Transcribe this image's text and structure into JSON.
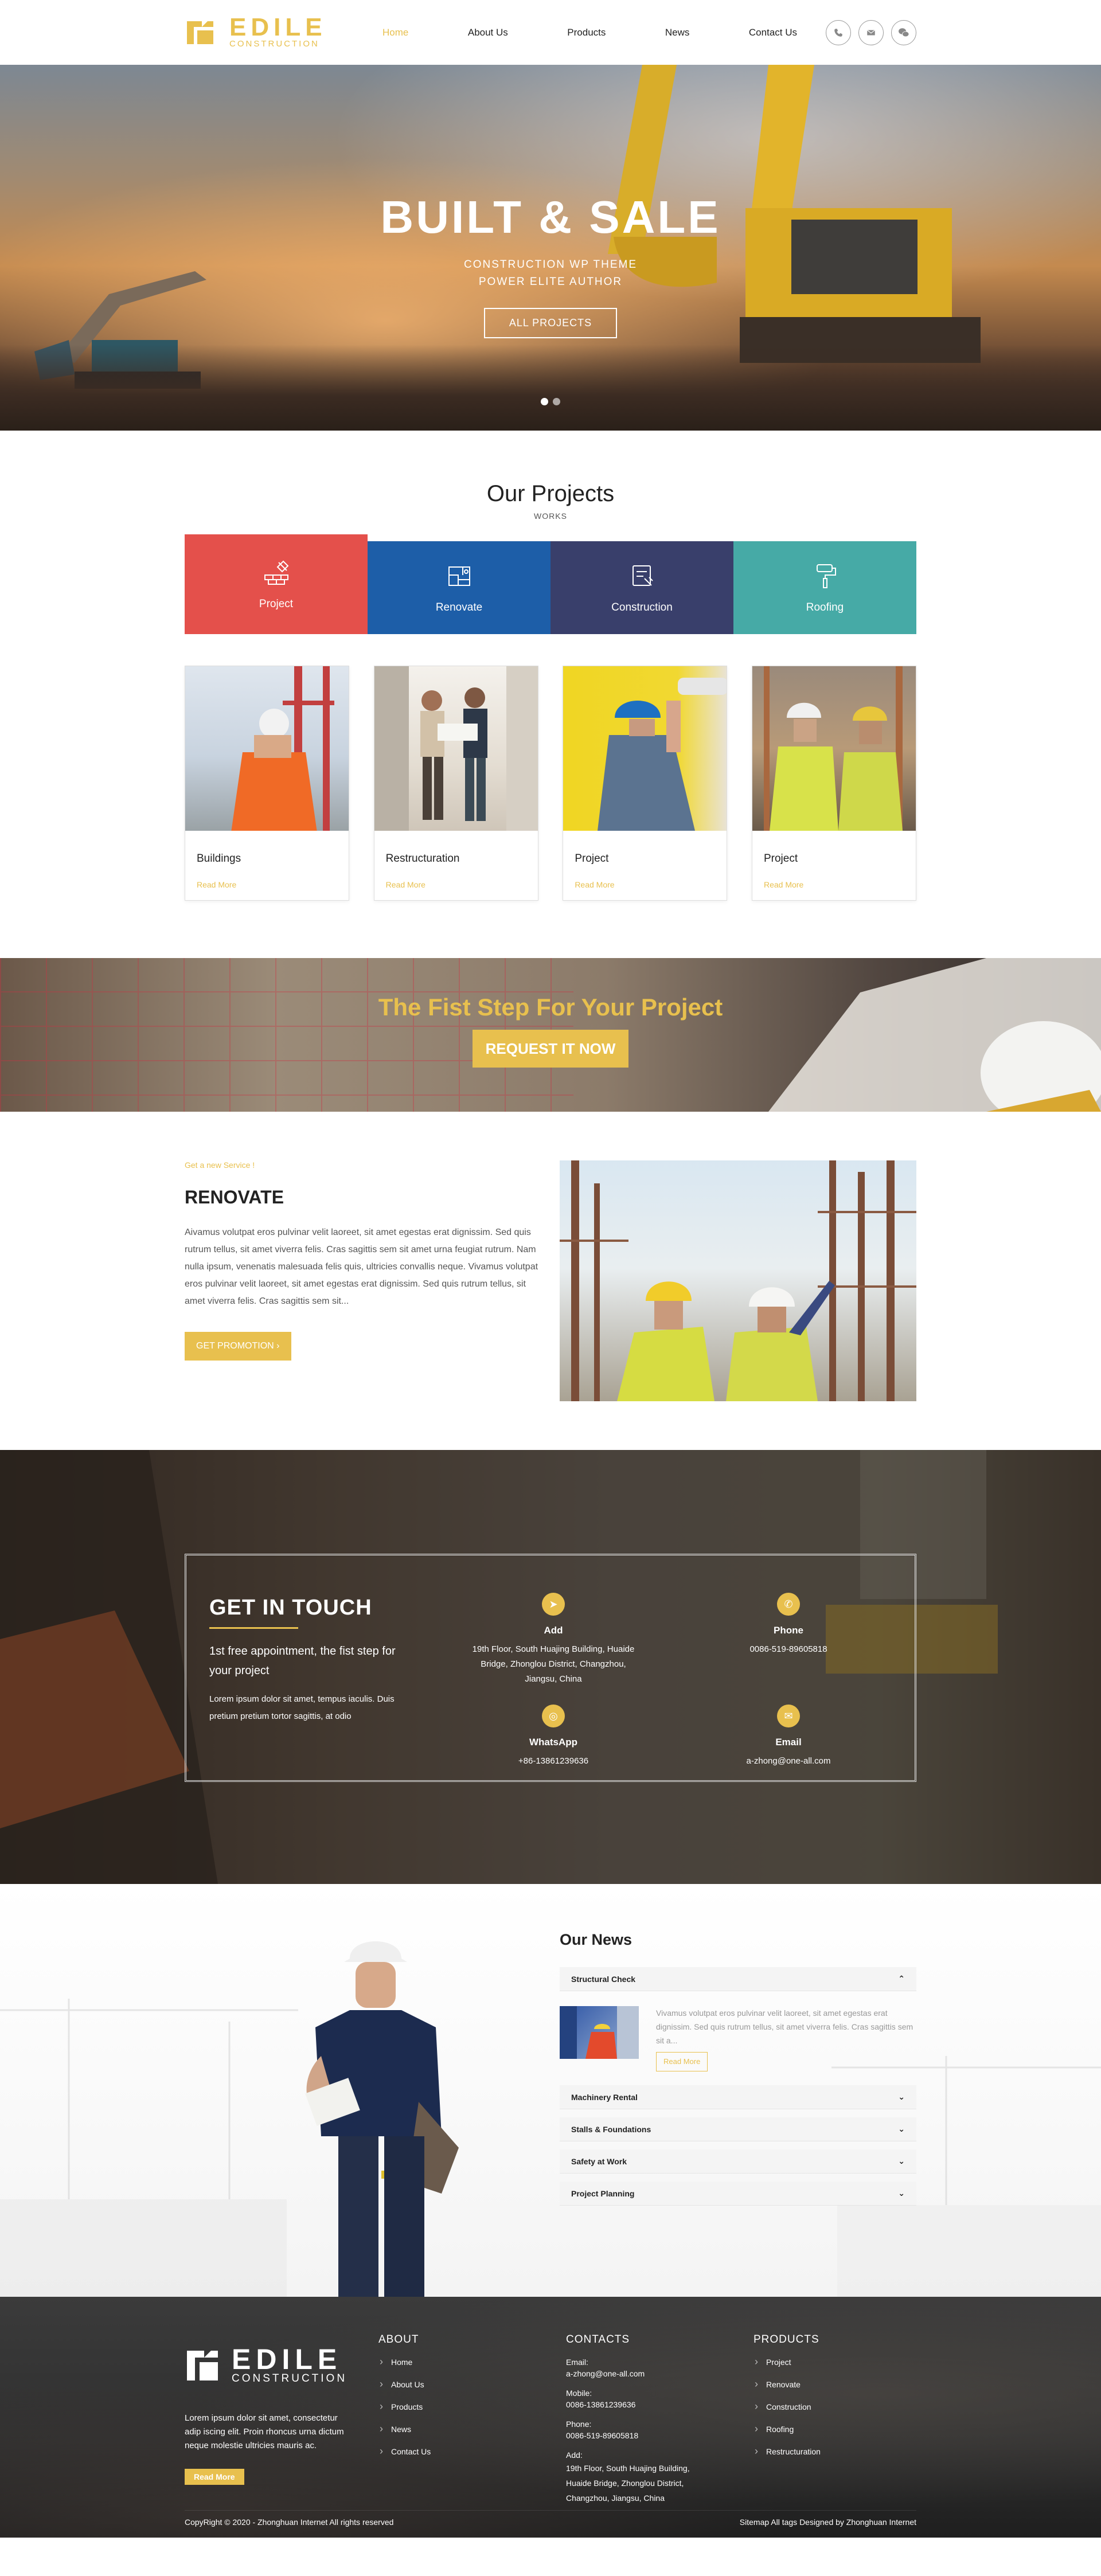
{
  "header": {
    "logo_big": "EDILE",
    "logo_small": "CONSTRUCTION",
    "nav": [
      "Home",
      "About Us",
      "Products",
      "News",
      "Contact Us"
    ],
    "icons": [
      "phone-icon",
      "mail-icon",
      "wechat-icon"
    ]
  },
  "hero": {
    "title": "BUILT & SALE",
    "sub1": "CONSTRUCTION WP THEME",
    "sub2": "POWER ELITE AUTHOR",
    "button": "ALL PROJECTS",
    "slides": 2,
    "active_slide": 1
  },
  "projects": {
    "title": "Our Projects",
    "subtitle": "WORKS",
    "tabs": [
      {
        "label": "Project",
        "color": "#e4504b",
        "icon": "bricks-icon"
      },
      {
        "label": "Renovate",
        "color": "#1d5ea8",
        "icon": "blueprint-icon"
      },
      {
        "label": "Construction",
        "color": "#393f6b",
        "icon": "tools-icon"
      },
      {
        "label": "Roofing",
        "color": "#46aaa6",
        "icon": "paint-roller-icon"
      }
    ],
    "cards": [
      {
        "title": "Buildings",
        "link": "Read More"
      },
      {
        "title": "Restructuration",
        "link": "Read More"
      },
      {
        "title": "Project",
        "link": "Read More"
      },
      {
        "title": "Project",
        "link": "Read More"
      }
    ]
  },
  "cta": {
    "title": "The Fist Step For Your Project",
    "button": "REQUEST IT NOW"
  },
  "renovate": {
    "kicker": "Get a new Service !",
    "title": "RENOVATE",
    "text": "Aivamus volutpat eros pulvinar velit laoreet, sit amet egestas erat dignissim. Sed quis rutrum tellus, sit amet viverra felis. Cras sagittis sem sit amet urna feugiat rutrum. Nam nulla ipsum, venenatis malesuada felis quis, ultricies convallis neque. Vivamus volutpat eros pulvinar velit laoreet, sit amet egestas erat dignissim. Sed quis rutrum tellus, sit amet viverra felis. Cras sagittis sem sit...",
    "button": "GET PROMOTION"
  },
  "touch": {
    "title": "GET IN TOUCH",
    "lead": "1st free appointment, the fist step for your project",
    "desc": "Lorem ipsum dolor sit amet, tempus iaculis. Duis pretium pretium tortor sagittis, at odio",
    "items": [
      {
        "label": "Add",
        "value": "19th Floor, South Huajing Building, Huaide Bridge, Zhonglou District, Changzhou, Jiangsu, China",
        "icon": "send-icon"
      },
      {
        "label": "Phone",
        "value": "0086-519-89605818",
        "icon": "phone-icon"
      },
      {
        "label": "WhatsApp",
        "value": "+86-13861239636",
        "icon": "whatsapp-icon"
      },
      {
        "label": "Email",
        "value": "a-zhong@one-all.com",
        "icon": "mail-icon"
      }
    ]
  },
  "news": {
    "title": "Our News",
    "open_item": {
      "title": "Structural Check",
      "text": "Vivamus volutpat eros pulvinar velit laoreet, sit amet egestas erat dignissim. Sed quis rutrum tellus, sit amet viverra felis. Cras sagittis sem sit a...",
      "button": "Read More"
    },
    "items": [
      "Machinery Rental",
      "Stalls & Foundations",
      "Safety at Work",
      "Project Planning"
    ]
  },
  "footer": {
    "logo_big": "EDILE",
    "logo_small": "CONSTRUCTION",
    "about_text": "Lorem ipsum dolor sit amet, consectetur adip iscing elit. Proin rhoncus urna dictum neque molestie ultricies mauris ac.",
    "about_btn": "Read More",
    "about_head": "ABOUT",
    "about_links": [
      "Home",
      "About Us",
      "Products",
      "News",
      "Contact Us"
    ],
    "contacts_head": "CONTACTS",
    "contacts": {
      "email_label": "Email:",
      "email": "a-zhong@one-all.com",
      "mobile_label": "Mobile:",
      "mobile": "0086-13861239636",
      "phone_label": "Phone:",
      "phone": "0086-519-89605818",
      "add_label": "Add:",
      "add": "19th Floor, South Huajing Building, Huaide Bridge, Zhonglou District, Changzhou, Jiangsu, China"
    },
    "products_head": "PRODUCTS",
    "products": [
      "Project",
      "Renovate",
      "Construction",
      "Roofing",
      "Restructuration"
    ],
    "copyright": "CopyRight © 2020 -   Zhonghuan Internet  All rights reserved",
    "bottom_links": "Sitemap  All tags   Designed by Zhonghuan Internet"
  },
  "colors": {
    "accent": "#e8c04e"
  }
}
